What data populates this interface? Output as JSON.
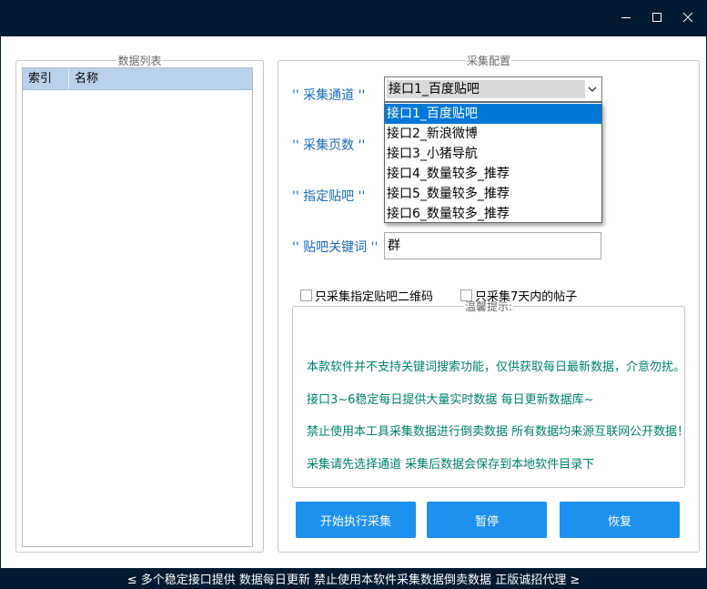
{
  "window": {
    "minimize_label": "minimize",
    "maximize_label": "maximize",
    "close_label": "close"
  },
  "list_group": {
    "title": "数据列表",
    "columns": [
      "索引",
      "名称"
    ]
  },
  "config_group": {
    "title": "采集配置",
    "channel_label": "'' 采集通道 ''",
    "pages_label": "'' 采集页数 ''",
    "bar_label": "'' 指定贴吧 ''",
    "keyword_label": "'' 贴吧关键词 ''",
    "channel_selected": "接口1_百度贴吧",
    "channel_options": [
      "接口1_百度贴吧",
      "接口2_新浪微博",
      "接口3_小猪导航",
      "接口4_数量较多_推荐",
      "接口5_数量较多_推荐",
      "接口6_数量较多_推荐"
    ],
    "keyword_value": "群",
    "checkbox_qrcode": "只采集指定贴吧二维码",
    "checkbox_7days": "只采集7天内的帖子"
  },
  "tips": {
    "title": "温馨提示:",
    "lines": [
      "本款软件并不支持关键词搜索功能，仅供获取每日最新数据，介意勿扰。",
      "接口3~6稳定每日提供大量实时数据 每日更新数据库~",
      "禁止使用本工具采集数据进行倒卖数据 所有数据均来源互联网公开数据！",
      "采集请先选择通道 采集后数据会保存到本地软件目录下"
    ]
  },
  "buttons": {
    "start": "开始执行采集",
    "pause": "暂停",
    "resume": "恢复"
  },
  "status_text": "≤ 多个稳定接口提供 数据每日更新 禁止使用本软件采集数据倒卖数据 正版诚招代理 ≥",
  "colors": {
    "title_bar": "#011a31",
    "label_blue": "#1b6bb8",
    "tip_green": "#00806a",
    "button_blue": "#1e90ee",
    "selection_blue": "#0078d7",
    "list_header": "#b9d1ea"
  },
  "icons": [
    "minimize-icon",
    "maximize-icon",
    "close-icon",
    "chevron-down-icon"
  ]
}
